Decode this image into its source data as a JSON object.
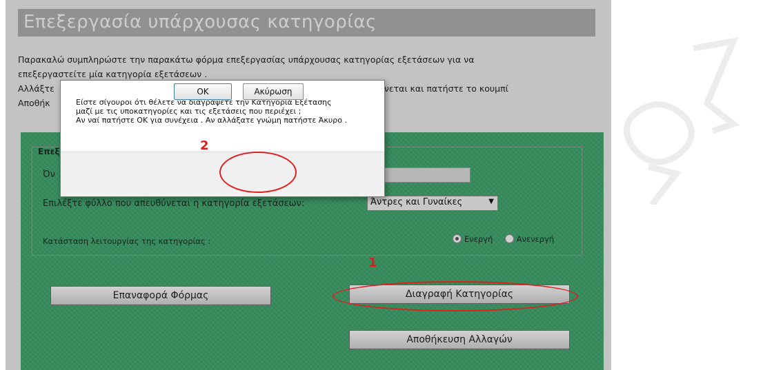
{
  "page": {
    "title": "Επεξεργασία υπάρχουσας κατηγορίας",
    "intro_line1": "Παρακαλώ συμπληρώστε την παρακάτω φόρμα επεξεργασίας υπάρχουσας κατηγορίας εξετάσεων για να",
    "intro_line2": "επεξεργαστείτε μία κατηγορία εξετάσεων .",
    "intro_line3_start": "Αλλάξτε",
    "intro_line3_end": "νεται και πατήστε το κουμπί",
    "intro_line4_start": "Αποθήκ"
  },
  "form": {
    "legend": "Επεξ",
    "name_label": "Όν",
    "name_value": "",
    "gender_label": "Επιλέξτε φύλλο που απευθύνεται η κατηγορία εξετάσεων:",
    "gender_selected": "Άντρες και Γυναίκες",
    "status_label": "Κατάσταση λειτουργίας της κατηγορίας :",
    "status_active": "Ενεργή",
    "status_inactive": "Ανενεργή",
    "reset_button": "Επαναφορά Φόρμας",
    "delete_button": "Διαγραφή Κατηγορίας",
    "save_button": "Αποθήκευση Αλλαγών"
  },
  "dialog": {
    "message_line1": "Είστε σίγουροι ότι θέλετε να διαγράψετε την Κατηγορία Εξέτασης",
    "message_line2": "μαζί με τις υποκατηγορίες και τις εξετάσεις που περιέχει ;",
    "message_line3": "Αν ναί πατήστε ΟΚ για συνέχεια . Αν αλλάξατε γνώμη πατήστε Άκυρο .",
    "ok_button": "OK",
    "cancel_button": "Ακύρωση"
  },
  "annotations": {
    "step1": "1",
    "step2": "2"
  },
  "colors": {
    "form_background": "#3ea06a",
    "header_background": "#a7a7a7",
    "annotation": "#e02020"
  }
}
